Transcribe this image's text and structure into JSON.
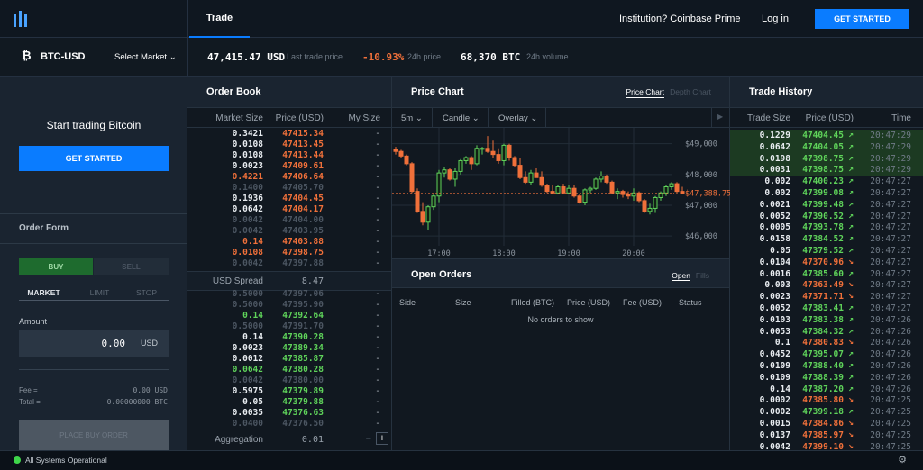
{
  "nav": {
    "tab": "Trade",
    "prime": "Institution? Coinbase Prime",
    "login": "Log in",
    "get_started": "GET STARTED"
  },
  "ticker": {
    "pair": "BTC-USD",
    "select": "Select Market",
    "price": "47,415.47 USD",
    "price_label": "Last trade price",
    "change": "-10.93%",
    "change_label": "24h price",
    "volume": "68,370 BTC",
    "volume_label": "24h volume"
  },
  "left": {
    "promo": "Start trading Bitcoin",
    "get_started": "GET STARTED",
    "order_form": "Order Form",
    "buy": "BUY",
    "sell": "SELL",
    "tabs": [
      "MARKET",
      "LIMIT",
      "STOP"
    ],
    "amount_label": "Amount",
    "amount": "0.00",
    "amount_unit": "USD",
    "fee_label": "Fee =",
    "fee": "0.00 USD",
    "total_label": "Total =",
    "total": "0.00000000 BTC",
    "place": "PLACE BUY ORDER"
  },
  "orderbook": {
    "title": "Order Book",
    "cols": [
      "Market Size",
      "Price (USD)",
      "My Size"
    ],
    "asks": [
      [
        "0.3421",
        "47415.34",
        "wht"
      ],
      [
        "0.0108",
        "47413.45",
        "wht"
      ],
      [
        "0.0108",
        "47413.44",
        "wht"
      ],
      [
        "0.0023",
        "47409.61",
        "wht"
      ],
      [
        "0.4221",
        "47406.64",
        "sell"
      ],
      [
        "0.1400",
        "47405.70",
        "dim"
      ],
      [
        "0.1936",
        "47404.45",
        "wht"
      ],
      [
        "0.0642",
        "47404.17",
        "wht"
      ],
      [
        "0.0042",
        "47404.00",
        "dim"
      ],
      [
        "0.0042",
        "47403.95",
        "dim"
      ],
      [
        "0.14",
        "47403.88",
        "sell"
      ],
      [
        "0.0108",
        "47398.75",
        "sell"
      ],
      [
        "0.0042",
        "47397.88",
        "dim"
      ]
    ],
    "spread_label": "USD Spread",
    "spread": "8.47",
    "bids": [
      [
        "0.5000",
        "47397.06",
        "dim"
      ],
      [
        "0.5000",
        "47395.90",
        "dim"
      ],
      [
        "0.14",
        "47392.64",
        "buy"
      ],
      [
        "0.5000",
        "47391.70",
        "dim"
      ],
      [
        "0.14",
        "47390.28",
        "wht"
      ],
      [
        "0.0023",
        "47389.34",
        "wht"
      ],
      [
        "0.0012",
        "47385.87",
        "wht"
      ],
      [
        "0.0642",
        "47380.28",
        "buy"
      ],
      [
        "0.0042",
        "47380.00",
        "dim"
      ],
      [
        "0.5975",
        "47379.89",
        "wht"
      ],
      [
        "0.05",
        "47379.88",
        "wht"
      ],
      [
        "0.0035",
        "47376.63",
        "wht"
      ],
      [
        "0.0400",
        "47376.50",
        "dim"
      ]
    ],
    "my_size": "-",
    "aggregation_label": "Aggregation",
    "aggregation": "0.01",
    "minus": "−",
    "plus": "+"
  },
  "chart": {
    "title": "Price Chart",
    "tabs": [
      "Price Chart",
      "Depth Chart"
    ],
    "interval": "5m",
    "type": "Candle",
    "overlay": "Overlay",
    "last_price": "$47,388.75"
  },
  "chart_data": {
    "type": "candlestick",
    "y_ticks": [
      "$49,000",
      "$48,000",
      "$47,000",
      "$46,000"
    ],
    "y_values": [
      49000,
      48000,
      47000,
      46000
    ],
    "ylim": [
      45800,
      49400
    ],
    "x_ticks": [
      "17:00",
      "18:00",
      "19:00",
      "20:00"
    ],
    "interval_minutes": 5,
    "first_candle": "16:20",
    "ohlc": [
      [
        48800,
        48900,
        48650,
        48750
      ],
      [
        48750,
        48800,
        48550,
        48600
      ],
      [
        48600,
        48650,
        48300,
        48350
      ],
      [
        48350,
        48400,
        47400,
        47450
      ],
      [
        47450,
        47550,
        46750,
        46800
      ],
      [
        46800,
        47100,
        46350,
        46450
      ],
      [
        46450,
        47000,
        46200,
        46950
      ],
      [
        46950,
        47400,
        46850,
        47300
      ],
      [
        47300,
        48150,
        47100,
        48050
      ],
      [
        48050,
        48250,
        47900,
        48150
      ],
      [
        48150,
        48200,
        47800,
        47850
      ],
      [
        47850,
        48200,
        47600,
        48100
      ],
      [
        48100,
        48500,
        48000,
        48450
      ],
      [
        48450,
        48600,
        48350,
        48550
      ],
      [
        48550,
        48600,
        48150,
        48350
      ],
      [
        48350,
        48950,
        48300,
        48850
      ],
      [
        48850,
        48900,
        48650,
        48850
      ],
      [
        48850,
        49250,
        48700,
        48750
      ],
      [
        48750,
        49100,
        48550,
        48650
      ],
      [
        48650,
        48850,
        48350,
        48450
      ],
      [
        48450,
        49000,
        48300,
        48950
      ],
      [
        48950,
        49000,
        48450,
        48550
      ],
      [
        48550,
        48600,
        48250,
        48300
      ],
      [
        48300,
        48550,
        47850,
        47900
      ],
      [
        47900,
        48100,
        47700,
        47750
      ],
      [
        47750,
        48150,
        47650,
        48050
      ],
      [
        48050,
        48200,
        47900,
        47900
      ],
      [
        47900,
        48100,
        47600,
        47650
      ],
      [
        47650,
        47700,
        47400,
        47450
      ],
      [
        47450,
        47650,
        47350,
        47400
      ],
      [
        47400,
        47650,
        47350,
        47600
      ],
      [
        47600,
        47700,
        47350,
        47400
      ],
      [
        47400,
        47650,
        47350,
        47550
      ],
      [
        47550,
        47650,
        47250,
        47300
      ],
      [
        47300,
        47350,
        47050,
        47100
      ],
      [
        47100,
        47550,
        47000,
        47500
      ],
      [
        47500,
        47600,
        47400,
        47550
      ],
      [
        47550,
        47900,
        47500,
        47850
      ],
      [
        47850,
        48100,
        47750,
        47950
      ],
      [
        47950,
        48000,
        47700,
        47750
      ],
      [
        47750,
        47800,
        47350,
        47400
      ],
      [
        47400,
        47550,
        47200,
        47450
      ],
      [
        47450,
        47500,
        47250,
        47350
      ],
      [
        47350,
        47450,
        47200,
        47300
      ],
      [
        47300,
        47550,
        47150,
        47400
      ],
      [
        47400,
        47450,
        47100,
        47150
      ],
      [
        47150,
        47200,
        46750,
        46800
      ],
      [
        46800,
        47050,
        46700,
        46900
      ],
      [
        46900,
        47300,
        46750,
        47250
      ],
      [
        47250,
        47450,
        47150,
        47400
      ],
      [
        47400,
        47650,
        47300,
        47600
      ],
      [
        47600,
        47750,
        47500,
        47700
      ],
      [
        47700,
        47750,
        47350,
        47450
      ],
      [
        47450,
        47600,
        47350,
        47388.75
      ]
    ]
  },
  "open_orders": {
    "title": "Open Orders",
    "tabs": [
      "Open",
      "Fills"
    ],
    "cols": [
      "Side",
      "Size",
      "Filled (BTC)",
      "Price (USD)",
      "Fee (USD)",
      "Status"
    ],
    "empty": "No orders to show"
  },
  "trades": {
    "title": "Trade History",
    "cols": [
      "Trade Size",
      "Price (USD)",
      "Time"
    ],
    "rows": [
      [
        "0.1229",
        "47404.45",
        "up",
        "20:47:29"
      ],
      [
        "0.0642",
        "47404.05",
        "up",
        "20:47:29"
      ],
      [
        "0.0198",
        "47398.75",
        "up",
        "20:47:29"
      ],
      [
        "0.0031",
        "47398.75",
        "up",
        "20:47:29"
      ],
      [
        "0.002",
        "47400.23",
        "up",
        "20:47:27"
      ],
      [
        "0.002",
        "47399.08",
        "up",
        "20:47:27"
      ],
      [
        "0.0021",
        "47399.48",
        "up",
        "20:47:27"
      ],
      [
        "0.0052",
        "47390.52",
        "up",
        "20:47:27"
      ],
      [
        "0.0005",
        "47393.78",
        "up",
        "20:47:27"
      ],
      [
        "0.0158",
        "47384.52",
        "up",
        "20:47:27"
      ],
      [
        "0.05",
        "47379.52",
        "up",
        "20:47:27"
      ],
      [
        "0.0104",
        "47370.96",
        "down",
        "20:47:27"
      ],
      [
        "0.0016",
        "47385.60",
        "up",
        "20:47:27"
      ],
      [
        "0.003",
        "47363.49",
        "down",
        "20:47:27"
      ],
      [
        "0.0023",
        "47371.71",
        "down",
        "20:47:27"
      ],
      [
        "0.0052",
        "47383.41",
        "up",
        "20:47:27"
      ],
      [
        "0.0103",
        "47383.38",
        "up",
        "20:47:26"
      ],
      [
        "0.0053",
        "47384.32",
        "up",
        "20:47:26"
      ],
      [
        "0.1",
        "47380.83",
        "down",
        "20:47:26"
      ],
      [
        "0.0452",
        "47395.07",
        "up",
        "20:47:26"
      ],
      [
        "0.0109",
        "47388.40",
        "up",
        "20:47:26"
      ],
      [
        "0.0109",
        "47388.39",
        "up",
        "20:47:26"
      ],
      [
        "0.14",
        "47387.20",
        "up",
        "20:47:26"
      ],
      [
        "0.0002",
        "47385.80",
        "down",
        "20:47:25"
      ],
      [
        "0.0002",
        "47399.18",
        "up",
        "20:47:25"
      ],
      [
        "0.0015",
        "47384.86",
        "down",
        "20:47:25"
      ],
      [
        "0.0137",
        "47385.97",
        "down",
        "20:47:25"
      ],
      [
        "0.0042",
        "47399.10",
        "down",
        "20:47:25"
      ]
    ]
  },
  "status": {
    "text": "All Systems Operational",
    "color": "#3fd64a"
  },
  "colors": {
    "accent": "#0a7cff",
    "buy": "#5fd35a",
    "sell": "#f0703a"
  }
}
